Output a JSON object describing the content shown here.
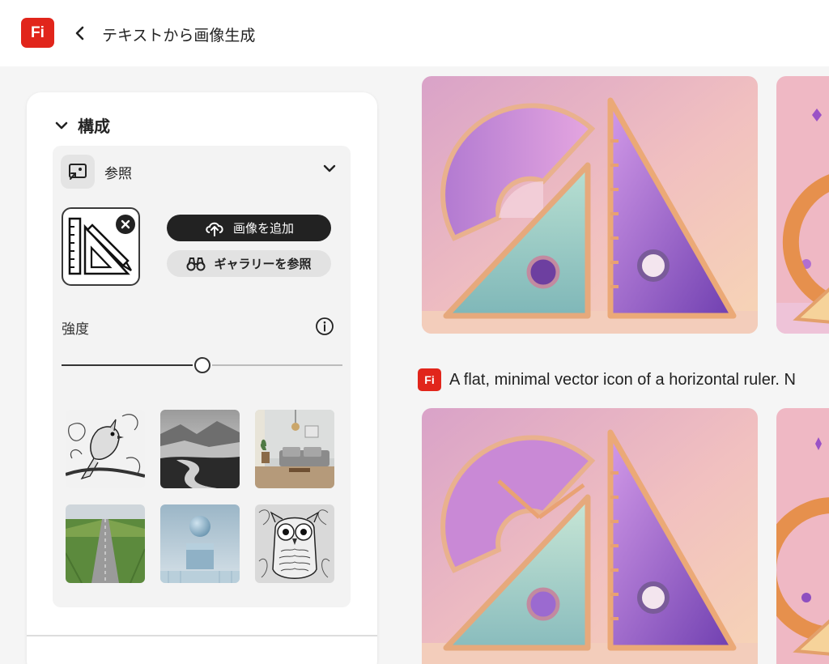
{
  "header": {
    "logo": "Fi",
    "title": "テキストから画像生成"
  },
  "composition": {
    "title": "構成",
    "reference": {
      "label": "参照",
      "upload_label": "画像を追加",
      "gallery_label": "ギャラリーを参照"
    },
    "strength": {
      "label": "強度",
      "value_fraction": 0.5
    },
    "gallery_thumbnails": [
      {
        "icon": "bird-sketch"
      },
      {
        "icon": "misty-lake"
      },
      {
        "icon": "living-room"
      },
      {
        "icon": "road-field"
      },
      {
        "icon": "sphere-cube"
      },
      {
        "icon": "owl-sketch"
      }
    ]
  },
  "results": {
    "prompt_logo": "Fi",
    "prompt": "A flat, minimal vector icon of a horizontal ruler. N"
  },
  "colors": {
    "brand": "#e1251b",
    "accent_dark": "#222222"
  }
}
